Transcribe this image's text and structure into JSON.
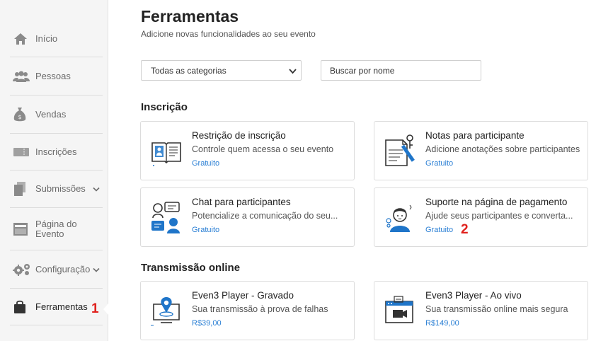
{
  "sidebar": {
    "items": [
      {
        "label": "Início",
        "icon": "home-icon"
      },
      {
        "label": "Pessoas",
        "icon": "people-icon"
      },
      {
        "label": "Vendas",
        "icon": "money-bag-icon"
      },
      {
        "label": "Inscrições",
        "icon": "ticket-icon"
      },
      {
        "label": "Submissões",
        "icon": "documents-icon"
      },
      {
        "label": "Página do Evento",
        "icon": "page-icon"
      },
      {
        "label": "Configuração",
        "icon": "gears-icon"
      },
      {
        "label": "Ferramentas",
        "icon": "bag-icon"
      }
    ],
    "annotation": "1"
  },
  "header": {
    "title": "Ferramentas",
    "subtitle": "Adicione novas funcionalidades ao seu evento"
  },
  "filters": {
    "category_selected": "Todas as categorias",
    "search_placeholder": "Buscar por nome"
  },
  "sections": [
    {
      "title": "Inscrição",
      "cards": [
        {
          "title": "Restrição de inscrição",
          "description": "Controle quem acessa o seu evento",
          "price": "Gratuito",
          "icon": "book-icon"
        },
        {
          "title": "Notas para participante",
          "description": "Adicione anotações sobre participantes",
          "price": "Gratuito",
          "icon": "notes-icon"
        },
        {
          "title": "Chat para participantes",
          "description": "Potencialize a comunicação do seu...",
          "price": "Gratuito",
          "icon": "chat-icon"
        },
        {
          "title": "Suporte na página de pagamento",
          "description": "Ajude seus participantes e converta...",
          "price": "Gratuito",
          "icon": "support-icon"
        }
      ]
    },
    {
      "title": "Transmissão online",
      "cards": [
        {
          "title": "Even3 Player - Gravado",
          "description": "Sua transmissão à prova de falhas",
          "price": "R$39,00",
          "icon": "recorded-player-icon"
        },
        {
          "title": "Even3 Player - Ao vivo",
          "description": "Sua transmissão online mais segura",
          "price": "R$149,00",
          "icon": "live-player-icon"
        }
      ]
    }
  ],
  "annotation_2": "2",
  "colors": {
    "accent": "#2a7fd4",
    "annotation": "#e0211d",
    "icon_gray": "#8a8a8a",
    "icon_blue": "#1f75c9"
  }
}
